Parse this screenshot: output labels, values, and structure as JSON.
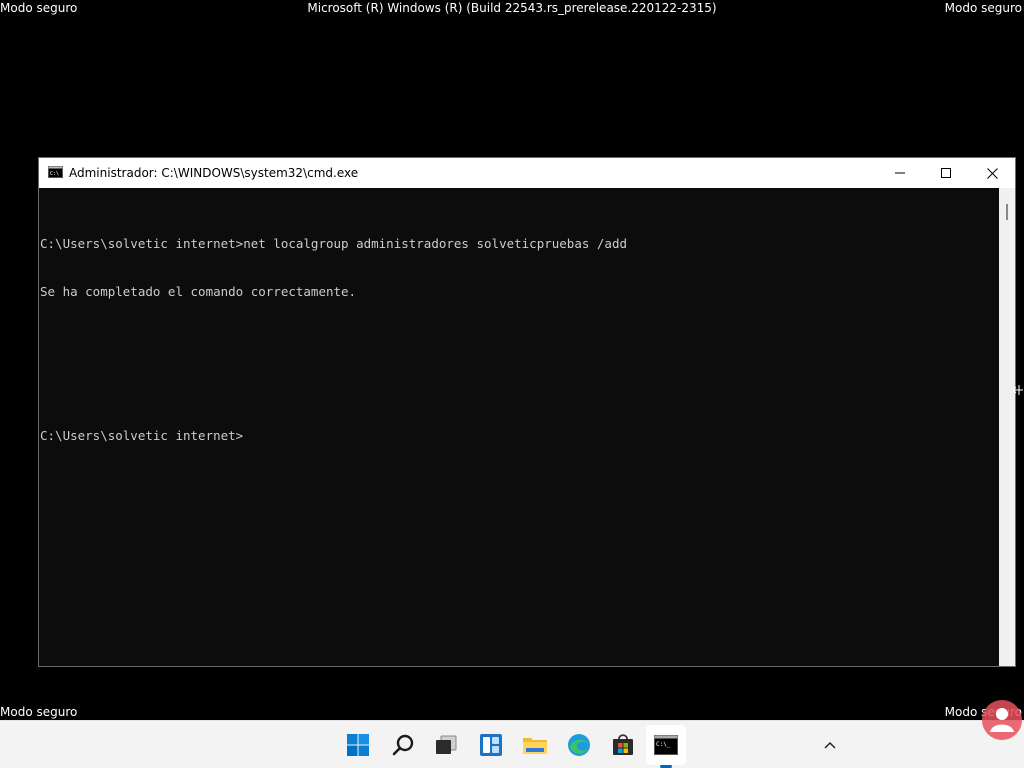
{
  "overlay": {
    "safe_mode_label": "Modo seguro",
    "build_title": "Microsoft (R) Windows (R) (Build 22543.rs_prerelease.220122-2315)"
  },
  "window": {
    "title": "Administrador: C:\\WINDOWS\\system32\\cmd.exe",
    "icon": "cmd-icon"
  },
  "console": {
    "lines": [
      "C:\\Users\\solvetic internet>net localgroup administradores solveticpruebas /add",
      "Se ha completado el comando correctamente.",
      "",
      "",
      "C:\\Users\\solvetic internet>"
    ]
  },
  "taskbar": {
    "icons": [
      "start-icon",
      "search-icon",
      "task-view-icon",
      "widgets-icon",
      "file-explorer-icon",
      "edge-icon",
      "store-icon",
      "cmd-icon"
    ],
    "active": "cmd-icon",
    "accent": "#0067c0"
  },
  "colors": {
    "desktop": "#000000",
    "console_bg": "#0c0c0c",
    "console_text": "#cccccc",
    "taskbar_bg": "#f3f3f3"
  }
}
